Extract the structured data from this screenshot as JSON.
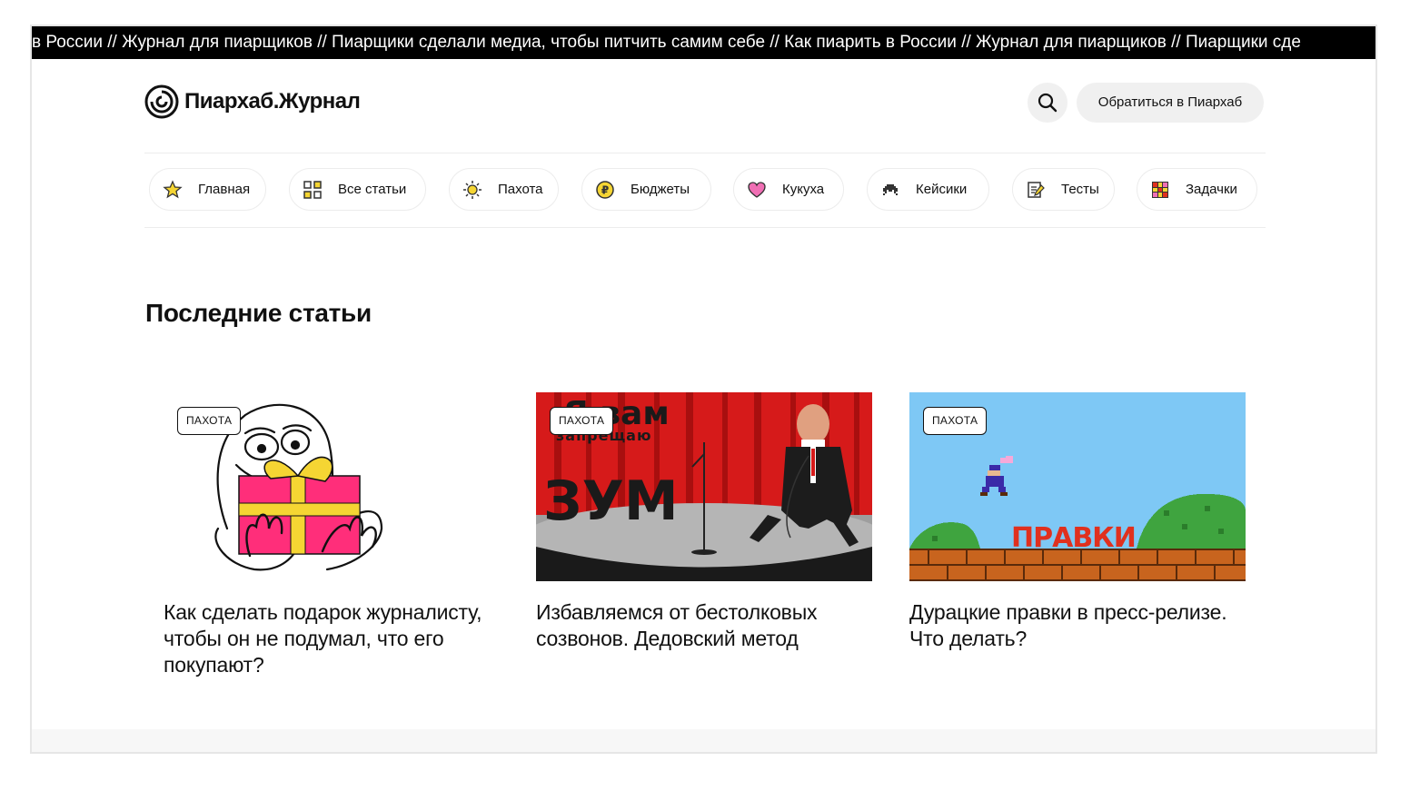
{
  "ticker": {
    "text": "в России // Журнал для пиарщиков // Пиарщики сделали медиа, чтобы питчить самим себе // Как пиарить в России // Журнал для пиарщиков //  Пиарщики сде"
  },
  "header": {
    "logo_text": "Пиархаб.Журнал",
    "contact_label": "Обратиться в Пиархаб"
  },
  "nav": {
    "items": [
      {
        "label": "Главная",
        "icon": "star-icon"
      },
      {
        "label": "Все статьи",
        "icon": "grid-icon"
      },
      {
        "label": "Пахота",
        "icon": "sun-icon"
      },
      {
        "label": "Бюджеты",
        "icon": "ruble-coin-icon"
      },
      {
        "label": "Кукуха",
        "icon": "heart-icon"
      },
      {
        "label": "Кейсики",
        "icon": "space-invader-icon"
      },
      {
        "label": "Тесты",
        "icon": "memo-icon"
      },
      {
        "label": "Задачки",
        "icon": "colored-grid-icon"
      }
    ]
  },
  "section": {
    "title": "Последние статьи"
  },
  "articles": [
    {
      "tag": "ПАХОТА",
      "title": "Как сделать подарок журналисту, чтобы он не подумал, что его покупают?"
    },
    {
      "tag": "ПАХОТА",
      "title": "Избавляемся от бестолковых созвонов. Дедовский метод",
      "image_text_1": "Я вам",
      "image_text_2": "запрещаю",
      "image_text_3": "ЗУМ"
    },
    {
      "tag": "ПАХОТА",
      "title": "Дурацкие правки в пресс-релизе. Что делать?",
      "image_text_1": "ПРАВКИ"
    }
  ],
  "colors": {
    "ticker_bg": "#000000",
    "pill_bg": "#f0f0f0",
    "curtain_red": "#d61a1a",
    "sky_blue": "#7ec8f5"
  }
}
